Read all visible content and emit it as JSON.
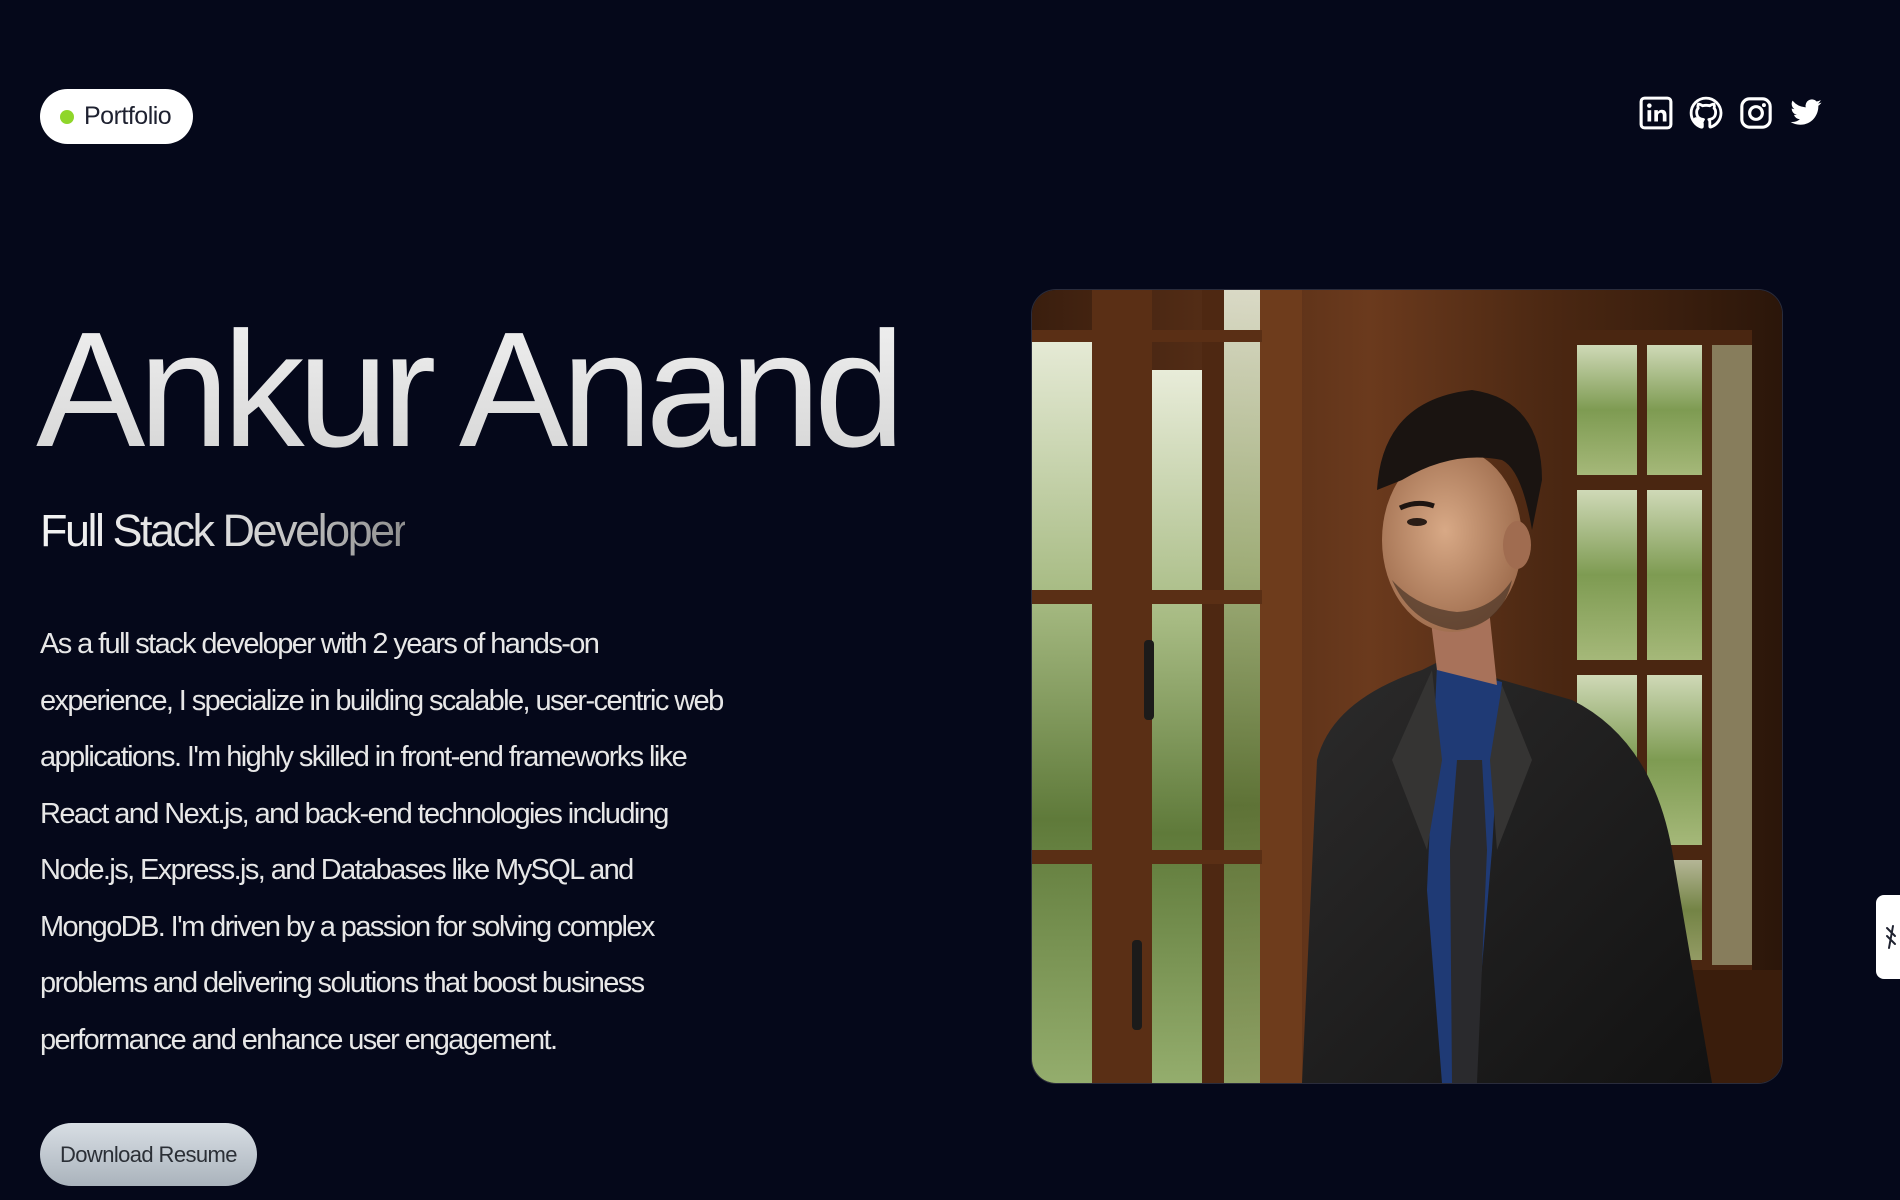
{
  "header": {
    "badge_label": "Portfolio",
    "badge_dot_color": "#8fd62a",
    "socials": [
      {
        "name": "LinkedIn",
        "icon": "linkedin-icon"
      },
      {
        "name": "GitHub",
        "icon": "github-icon"
      },
      {
        "name": "Instagram",
        "icon": "instagram-icon"
      },
      {
        "name": "Twitter",
        "icon": "twitter-icon"
      }
    ]
  },
  "hero": {
    "name": "Ankur Anand",
    "role": "Full Stack Developer",
    "bio": "As a full stack developer with 2 years of hands-on experience, I specialize in building scalable, user-centric web applications. I'm highly skilled in front-end frameworks like React and Next.js, and back-end technologies including Node.js, Express.js, and Databases like MySQL and MongoDB. I'm driven by a passion for solving complex problems and delivering solutions that boost business performance and enhance user engagement.",
    "resume_button": "Download Resume"
  },
  "portrait": {
    "icon": "profile-photo"
  },
  "colors": {
    "background": "#05081a",
    "text": "#e9e9e9",
    "accent_dot": "#8fd62a"
  }
}
